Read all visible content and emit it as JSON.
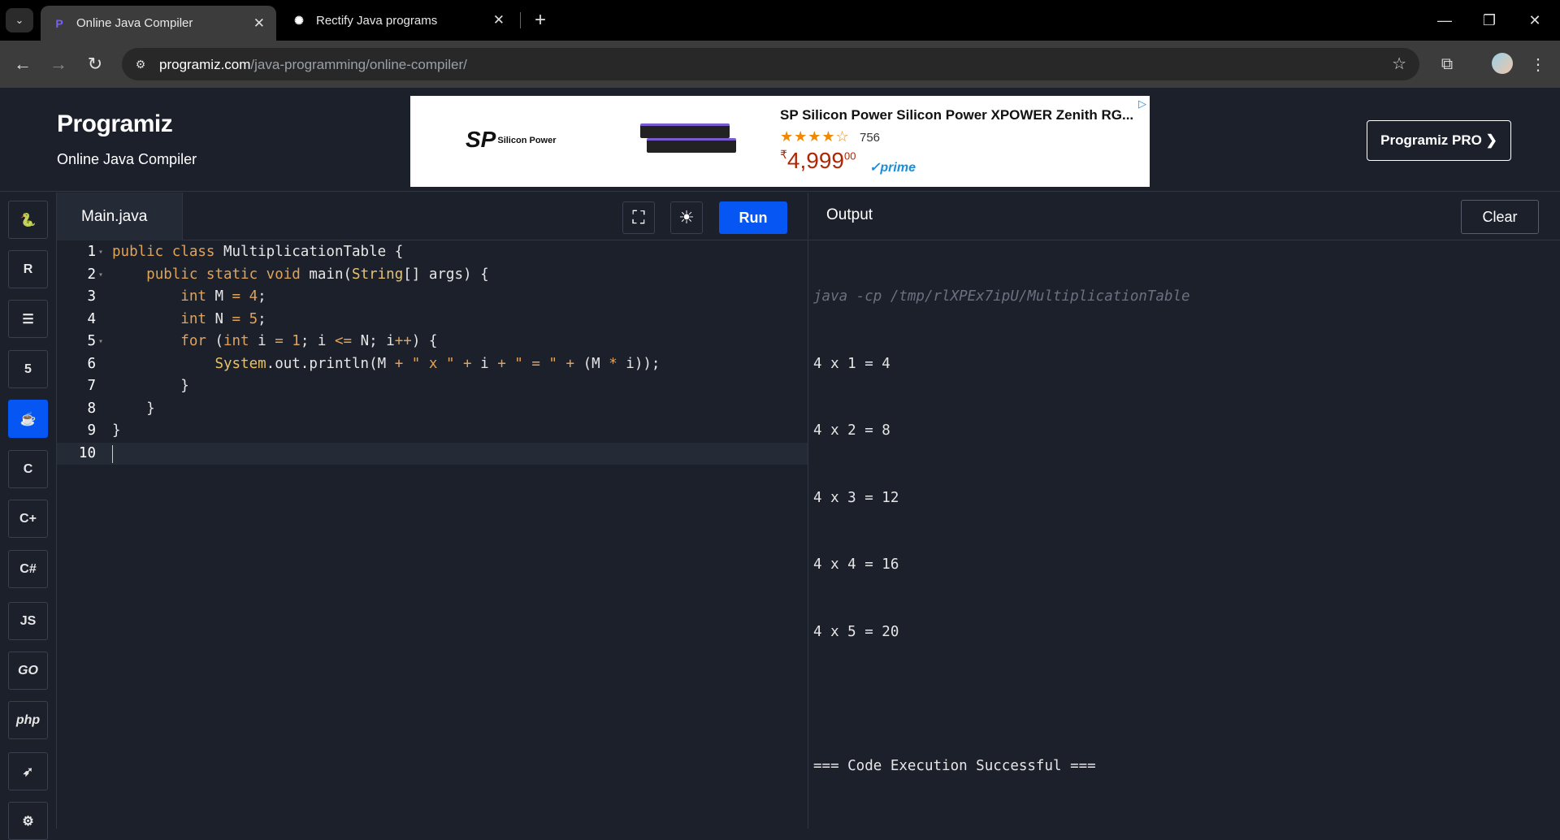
{
  "browser": {
    "tabs": [
      {
        "title": "Online Java Compiler",
        "active": true
      },
      {
        "title": "Rectify Java programs",
        "active": false
      }
    ],
    "url_domain": "programiz.com",
    "url_path": "/java-programming/online-compiler/"
  },
  "header": {
    "logo": "Programiz",
    "subtitle": "Online Java Compiler",
    "pro_button": "Programiz PRO ❯"
  },
  "ad": {
    "brand": "SP",
    "brand_small": "Silicon Power",
    "title": "SP Silicon Power Silicon Power XPOWER Zenith RG...",
    "stars": "★★★★☆",
    "review_count": "756",
    "currency": "₹",
    "price": "4,999",
    "price_cents": "00",
    "prime": "✓prime"
  },
  "sidebar": {
    "languages": [
      "python",
      "r",
      "sql",
      "html",
      "java",
      "c",
      "cpp",
      "csharp",
      "js",
      "go",
      "php",
      "swift",
      "rust"
    ],
    "labels": {
      "js": "JS",
      "go": "GO",
      "php": "php",
      "c": "C",
      "cpp": "C+",
      "csharp": "C#",
      "html": "5",
      "r": "R"
    }
  },
  "editor": {
    "file_name": "Main.java",
    "run_label": "Run",
    "line_numbers": [
      "1",
      "2",
      "3",
      "4",
      "5",
      "6",
      "7",
      "8",
      "9",
      "10"
    ]
  },
  "output": {
    "title": "Output",
    "clear_label": "Clear",
    "command": "java -cp /tmp/rlXPEx7ipU/MultiplicationTable",
    "lines": [
      "4 x 1 = 4",
      "4 x 2 = 8",
      "4 x 3 = 12",
      "4 x 4 = 16",
      "4 x 5 = 20",
      "",
      "=== Code Execution Successful ==="
    ]
  }
}
